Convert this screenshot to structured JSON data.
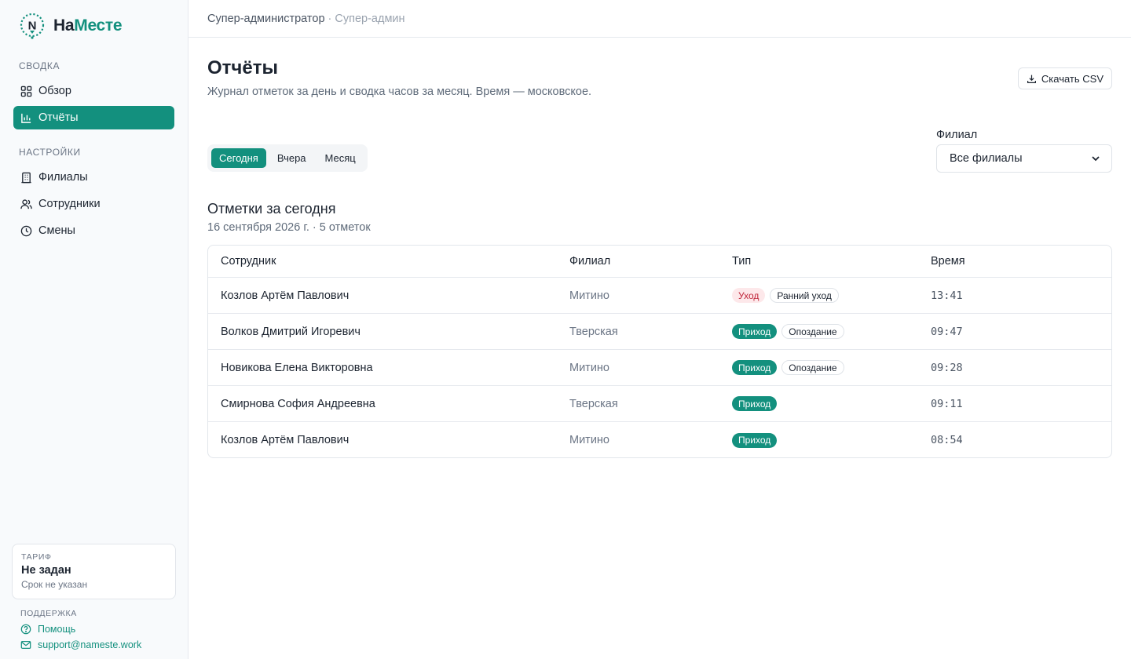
{
  "brand": {
    "name_part1": "На",
    "name_part2": "Месте",
    "logo_letter": "N"
  },
  "sidebar": {
    "section_summary": "Сводка",
    "overview": "Обзор",
    "reports": "Отчёты",
    "section_settings": "Настройки",
    "branches": "Филиалы",
    "employees": "Сотрудники",
    "shifts": "Смены",
    "plan": {
      "label": "Тариф",
      "name": "Не задан",
      "expiry": "Срок не указан"
    },
    "support": {
      "label": "Поддержка",
      "help": "Помощь",
      "email": "support@nameste.work"
    }
  },
  "topbar": {
    "user": "Супер-администратор",
    "separator": "·",
    "role": "Супер-админ"
  },
  "page": {
    "title": "Отчёты",
    "description": "Журнал отметок за день и сводка часов за месяц. Время — московское.",
    "csv_button": "Скачать CSV"
  },
  "periods": {
    "today": "Сегодня",
    "yesterday": "Вчера",
    "month": "Месяц"
  },
  "filter": {
    "label": "Филиал",
    "value": "Все филиалы"
  },
  "section": {
    "title": "Отметки за сегодня",
    "subtitle": "16 сентября 2026 г. · 5 отметок"
  },
  "table": {
    "headers": {
      "employee": "Сотрудник",
      "branch": "Филиал",
      "type": "Тип",
      "time": "Время"
    },
    "rows": [
      {
        "employee": "Козлов Артём Павлович",
        "branch": "Митино",
        "type": "Уход",
        "type_kind": "out",
        "note": "Ранний уход",
        "time": "13:41"
      },
      {
        "employee": "Волков Дмитрий Игоревич",
        "branch": "Тверская",
        "type": "Приход",
        "type_kind": "in",
        "note": "Опоздание",
        "time": "09:47"
      },
      {
        "employee": "Новикова Елена Викторовна",
        "branch": "Митино",
        "type": "Приход",
        "type_kind": "in",
        "note": "Опоздание",
        "time": "09:28"
      },
      {
        "employee": "Смирнова София Андреевна",
        "branch": "Тверская",
        "type": "Приход",
        "type_kind": "in",
        "note": "",
        "time": "09:11"
      },
      {
        "employee": "Козлов Артём Павлович",
        "branch": "Митино",
        "type": "Приход",
        "type_kind": "in",
        "note": "",
        "time": "08:54"
      }
    ]
  },
  "colors": {
    "accent": "#13907e",
    "danger": "#c0263a",
    "danger_bg": "#fde8ea"
  }
}
